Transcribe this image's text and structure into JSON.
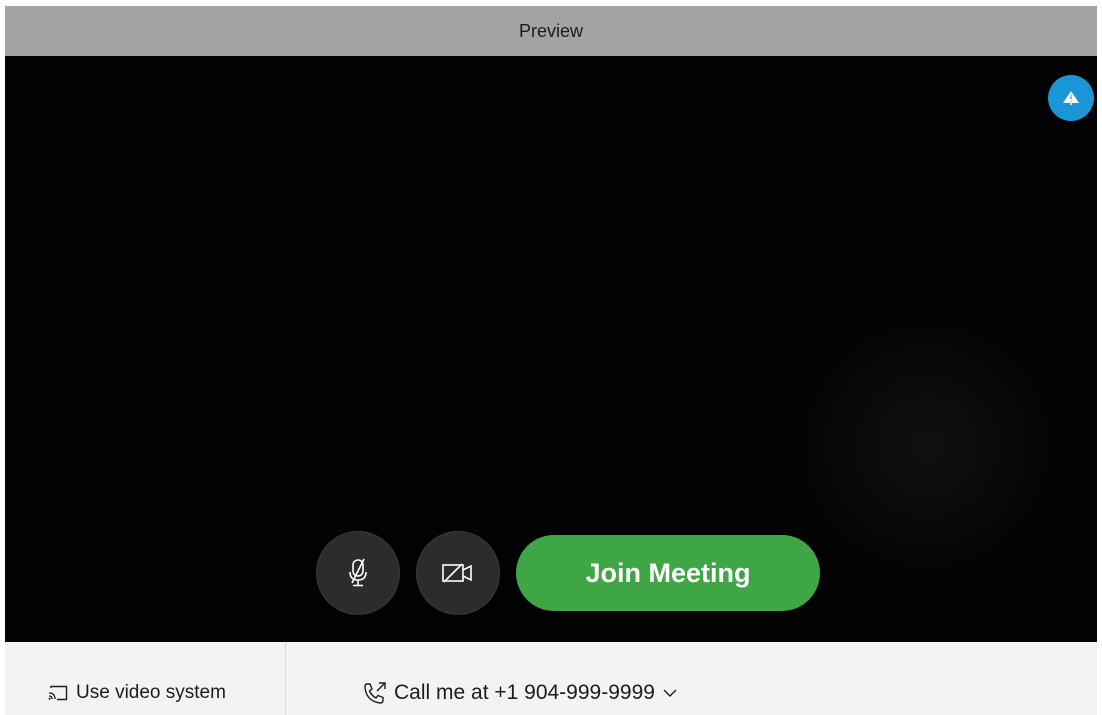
{
  "window": {
    "title": "Preview"
  },
  "preview": {
    "float_button_icon": "tent-icon",
    "mute_icon": "microphone-muted-icon",
    "video_icon": "video-off-icon",
    "join_label": "Join Meeting"
  },
  "bottom": {
    "video_system_icon": "cast-icon",
    "video_system_label": "Use video system",
    "call_icon": "phone-callback-icon",
    "call_label": "Call me at +1 904-999-9999",
    "call_dropdown_icon": "chevron-down-icon"
  },
  "colors": {
    "title_bar": "#a3a3a3",
    "preview_bg": "#020202",
    "float_button": "#1a95d6",
    "join_button": "#3ea645",
    "round_button": "#2c2c2c",
    "bottom_bar": "#f3f3f3"
  }
}
